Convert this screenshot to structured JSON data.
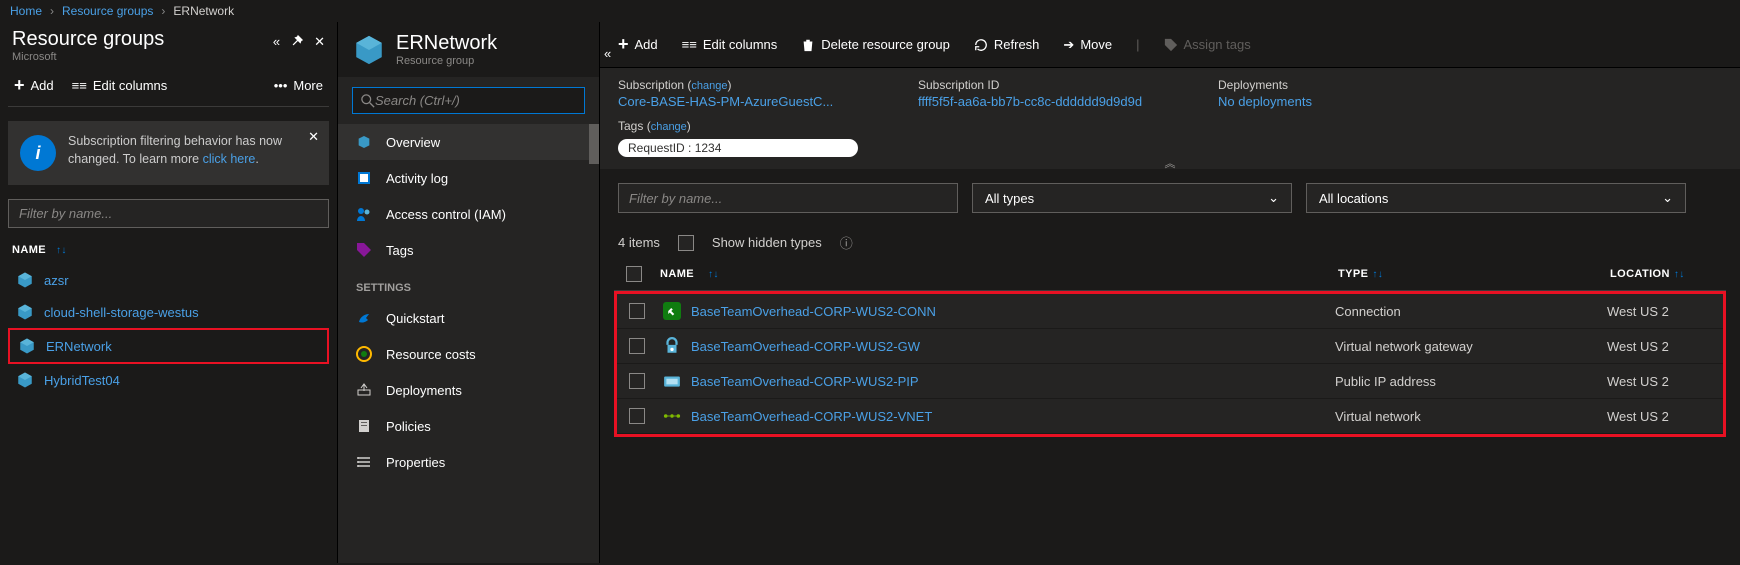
{
  "breadcrumbs": {
    "home": "Home",
    "rg": "Resource groups",
    "cur": "ERNetwork"
  },
  "left": {
    "title": "Resource groups",
    "subtitle": "Microsoft",
    "add": "Add",
    "editcols": "Edit columns",
    "more": "More",
    "info": {
      "text": "Subscription filtering behavior has now changed. To learn more ",
      "link": "click here"
    },
    "filter_ph": "Filter by name...",
    "col_name": "NAME",
    "items": [
      {
        "label": "azsr"
      },
      {
        "label": "cloud-shell-storage-westus"
      },
      {
        "label": "ERNetwork"
      },
      {
        "label": "HybridTest04"
      }
    ]
  },
  "mid": {
    "title": "ERNetwork",
    "subtitle": "Resource group",
    "search_ph": "Search (Ctrl+/)",
    "nav": [
      {
        "label": "Overview"
      },
      {
        "label": "Activity log"
      },
      {
        "label": "Access control (IAM)"
      },
      {
        "label": "Tags"
      }
    ],
    "section": "SETTINGS",
    "settings": [
      {
        "label": "Quickstart"
      },
      {
        "label": "Resource costs"
      },
      {
        "label": "Deployments"
      },
      {
        "label": "Policies"
      },
      {
        "label": "Properties"
      }
    ]
  },
  "right": {
    "toolbar": {
      "add": "Add",
      "editcols": "Edit columns",
      "delete": "Delete resource group",
      "refresh": "Refresh",
      "move": "Move",
      "assigntags": "Assign tags"
    },
    "essentials": {
      "sub_label": "Subscription",
      "change": "change",
      "sub_val": "Core-BASE-HAS-PM-AzureGuestC...",
      "subid_label": "Subscription ID",
      "subid_val": "ffff5f5f-aa6a-bb7b-cc8c-dddddd9d9d9d",
      "dep_label": "Deployments",
      "dep_val": "No deployments",
      "tags_label": "Tags",
      "tag_pill": "RequestID : 1234"
    },
    "filter_ph": "Filter by name...",
    "dd_types": "All types",
    "dd_loc": "All locations",
    "items_count": "4 items",
    "show_hidden": "Show hidden types",
    "headers": {
      "name": "NAME",
      "type": "TYPE",
      "loc": "LOCATION"
    },
    "rows": [
      {
        "name": "BaseTeamOverhead-CORP-WUS2-CONN",
        "type": "Connection",
        "loc": "West US 2",
        "icon": "conn"
      },
      {
        "name": "BaseTeamOverhead-CORP-WUS2-GW",
        "type": "Virtual network gateway",
        "loc": "West US 2",
        "icon": "gw"
      },
      {
        "name": "BaseTeamOverhead-CORP-WUS2-PIP",
        "type": "Public IP address",
        "loc": "West US 2",
        "icon": "pip"
      },
      {
        "name": "BaseTeamOverhead-CORP-WUS2-VNET",
        "type": "Virtual network",
        "loc": "West US 2",
        "icon": "vnet"
      }
    ]
  }
}
